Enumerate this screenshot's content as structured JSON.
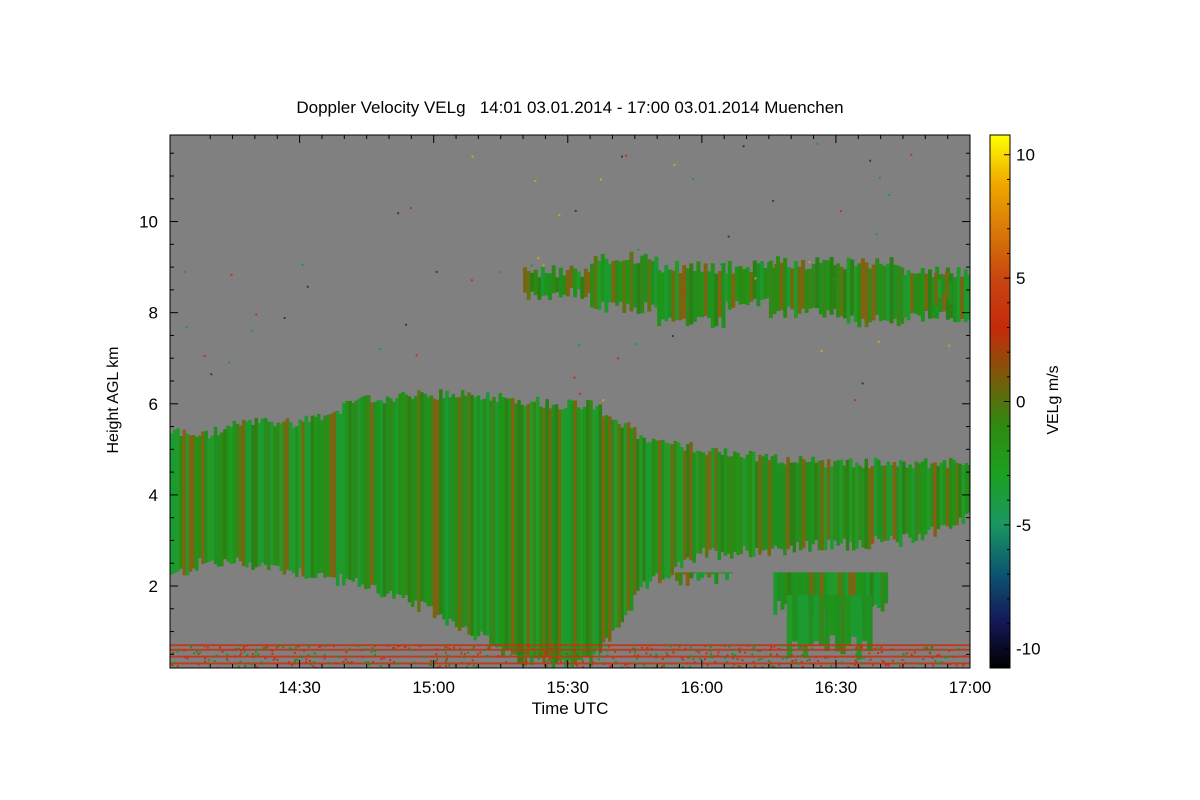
{
  "chart_data": {
    "type": "heatmap",
    "title": "Doppler Velocity VELg   14:01 03.01.2014 - 17:00 03.01.2014 Muenchen",
    "xlabel": "Time UTC",
    "ylabel": "Height AGL km",
    "colorbar_label": "VELg m/s",
    "x_ticks": [
      "14:30",
      "15:00",
      "15:30",
      "16:00",
      "16:30",
      "17:00"
    ],
    "x_tick_minutes": [
      30,
      60,
      90,
      120,
      150,
      180
    ],
    "xlim_minutes": [
      1,
      180
    ],
    "y_ticks": [
      "2",
      "4",
      "6",
      "8",
      "10"
    ],
    "y_tick_values": [
      2,
      4,
      6,
      8,
      10
    ],
    "ylim": [
      0.2,
      11.9
    ],
    "colorbar_ticks": [
      "10",
      "5",
      "0",
      "-5",
      "-10"
    ],
    "colorbar_tick_values": [
      10,
      5,
      0,
      -5,
      -10
    ],
    "colorbar_range": [
      -10.8,
      10.8
    ],
    "colorscale": [
      "#000000",
      "#141a5a",
      "#0c5870",
      "#1a9860",
      "#1ca020",
      "#2e8a10",
      "#7a5a0a",
      "#c42a0a",
      "#c84410",
      "#d87808",
      "#f0a800",
      "#ffff00"
    ],
    "background_color": "#808080",
    "grid": false
  }
}
